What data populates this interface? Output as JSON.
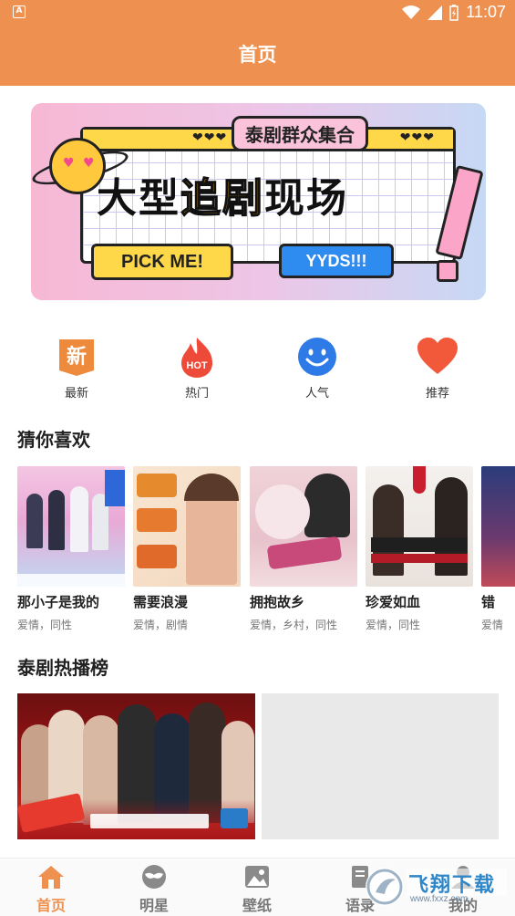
{
  "status_bar": {
    "time": "11:07",
    "app_badge": "A"
  },
  "header": {
    "title": "首页"
  },
  "banner": {
    "tag": "泰剧群众集合",
    "headline_pre": "大型",
    "headline_highlight": "追剧",
    "headline_post": "现场",
    "pill_left": "PICK ME!",
    "pill_right": "YYDS!!!",
    "hearts": "❤❤❤"
  },
  "categories": [
    {
      "label": "最新",
      "icon": "new-badge-icon",
      "glyph": "新"
    },
    {
      "label": "热门",
      "icon": "hot-flame-icon",
      "glyph": "HOT"
    },
    {
      "label": "人气",
      "icon": "smiley-icon"
    },
    {
      "label": "推荐",
      "icon": "heart-icon"
    }
  ],
  "sections": {
    "recommend": "猜你喜欢",
    "hot_rank": "泰剧热播榜"
  },
  "recommend_items": [
    {
      "title": "那小子是我的",
      "tags": "爱情，同性"
    },
    {
      "title": "需要浪漫",
      "tags": "爱情，剧情"
    },
    {
      "title": "拥抱故乡",
      "tags": "爱情，乡村，同性"
    },
    {
      "title": "珍爱如血",
      "tags": "爱情，同性"
    },
    {
      "title": "错",
      "tags": "爱情"
    }
  ],
  "bottom_nav": [
    {
      "label": "首页",
      "icon": "home-icon",
      "active": true
    },
    {
      "label": "明星",
      "icon": "star-mask-icon",
      "active": false
    },
    {
      "label": "壁纸",
      "icon": "picture-icon",
      "active": false
    },
    {
      "label": "语录",
      "icon": "quote-book-icon",
      "active": false
    },
    {
      "label": "我的",
      "icon": "profile-icon",
      "active": false
    }
  ],
  "watermark": {
    "text": "飞翔下载",
    "url_text": "www.fxxz.com"
  },
  "colors": {
    "accent": "#EE9150",
    "nav_active": "#EE9150",
    "nav_inactive": "#777777"
  }
}
